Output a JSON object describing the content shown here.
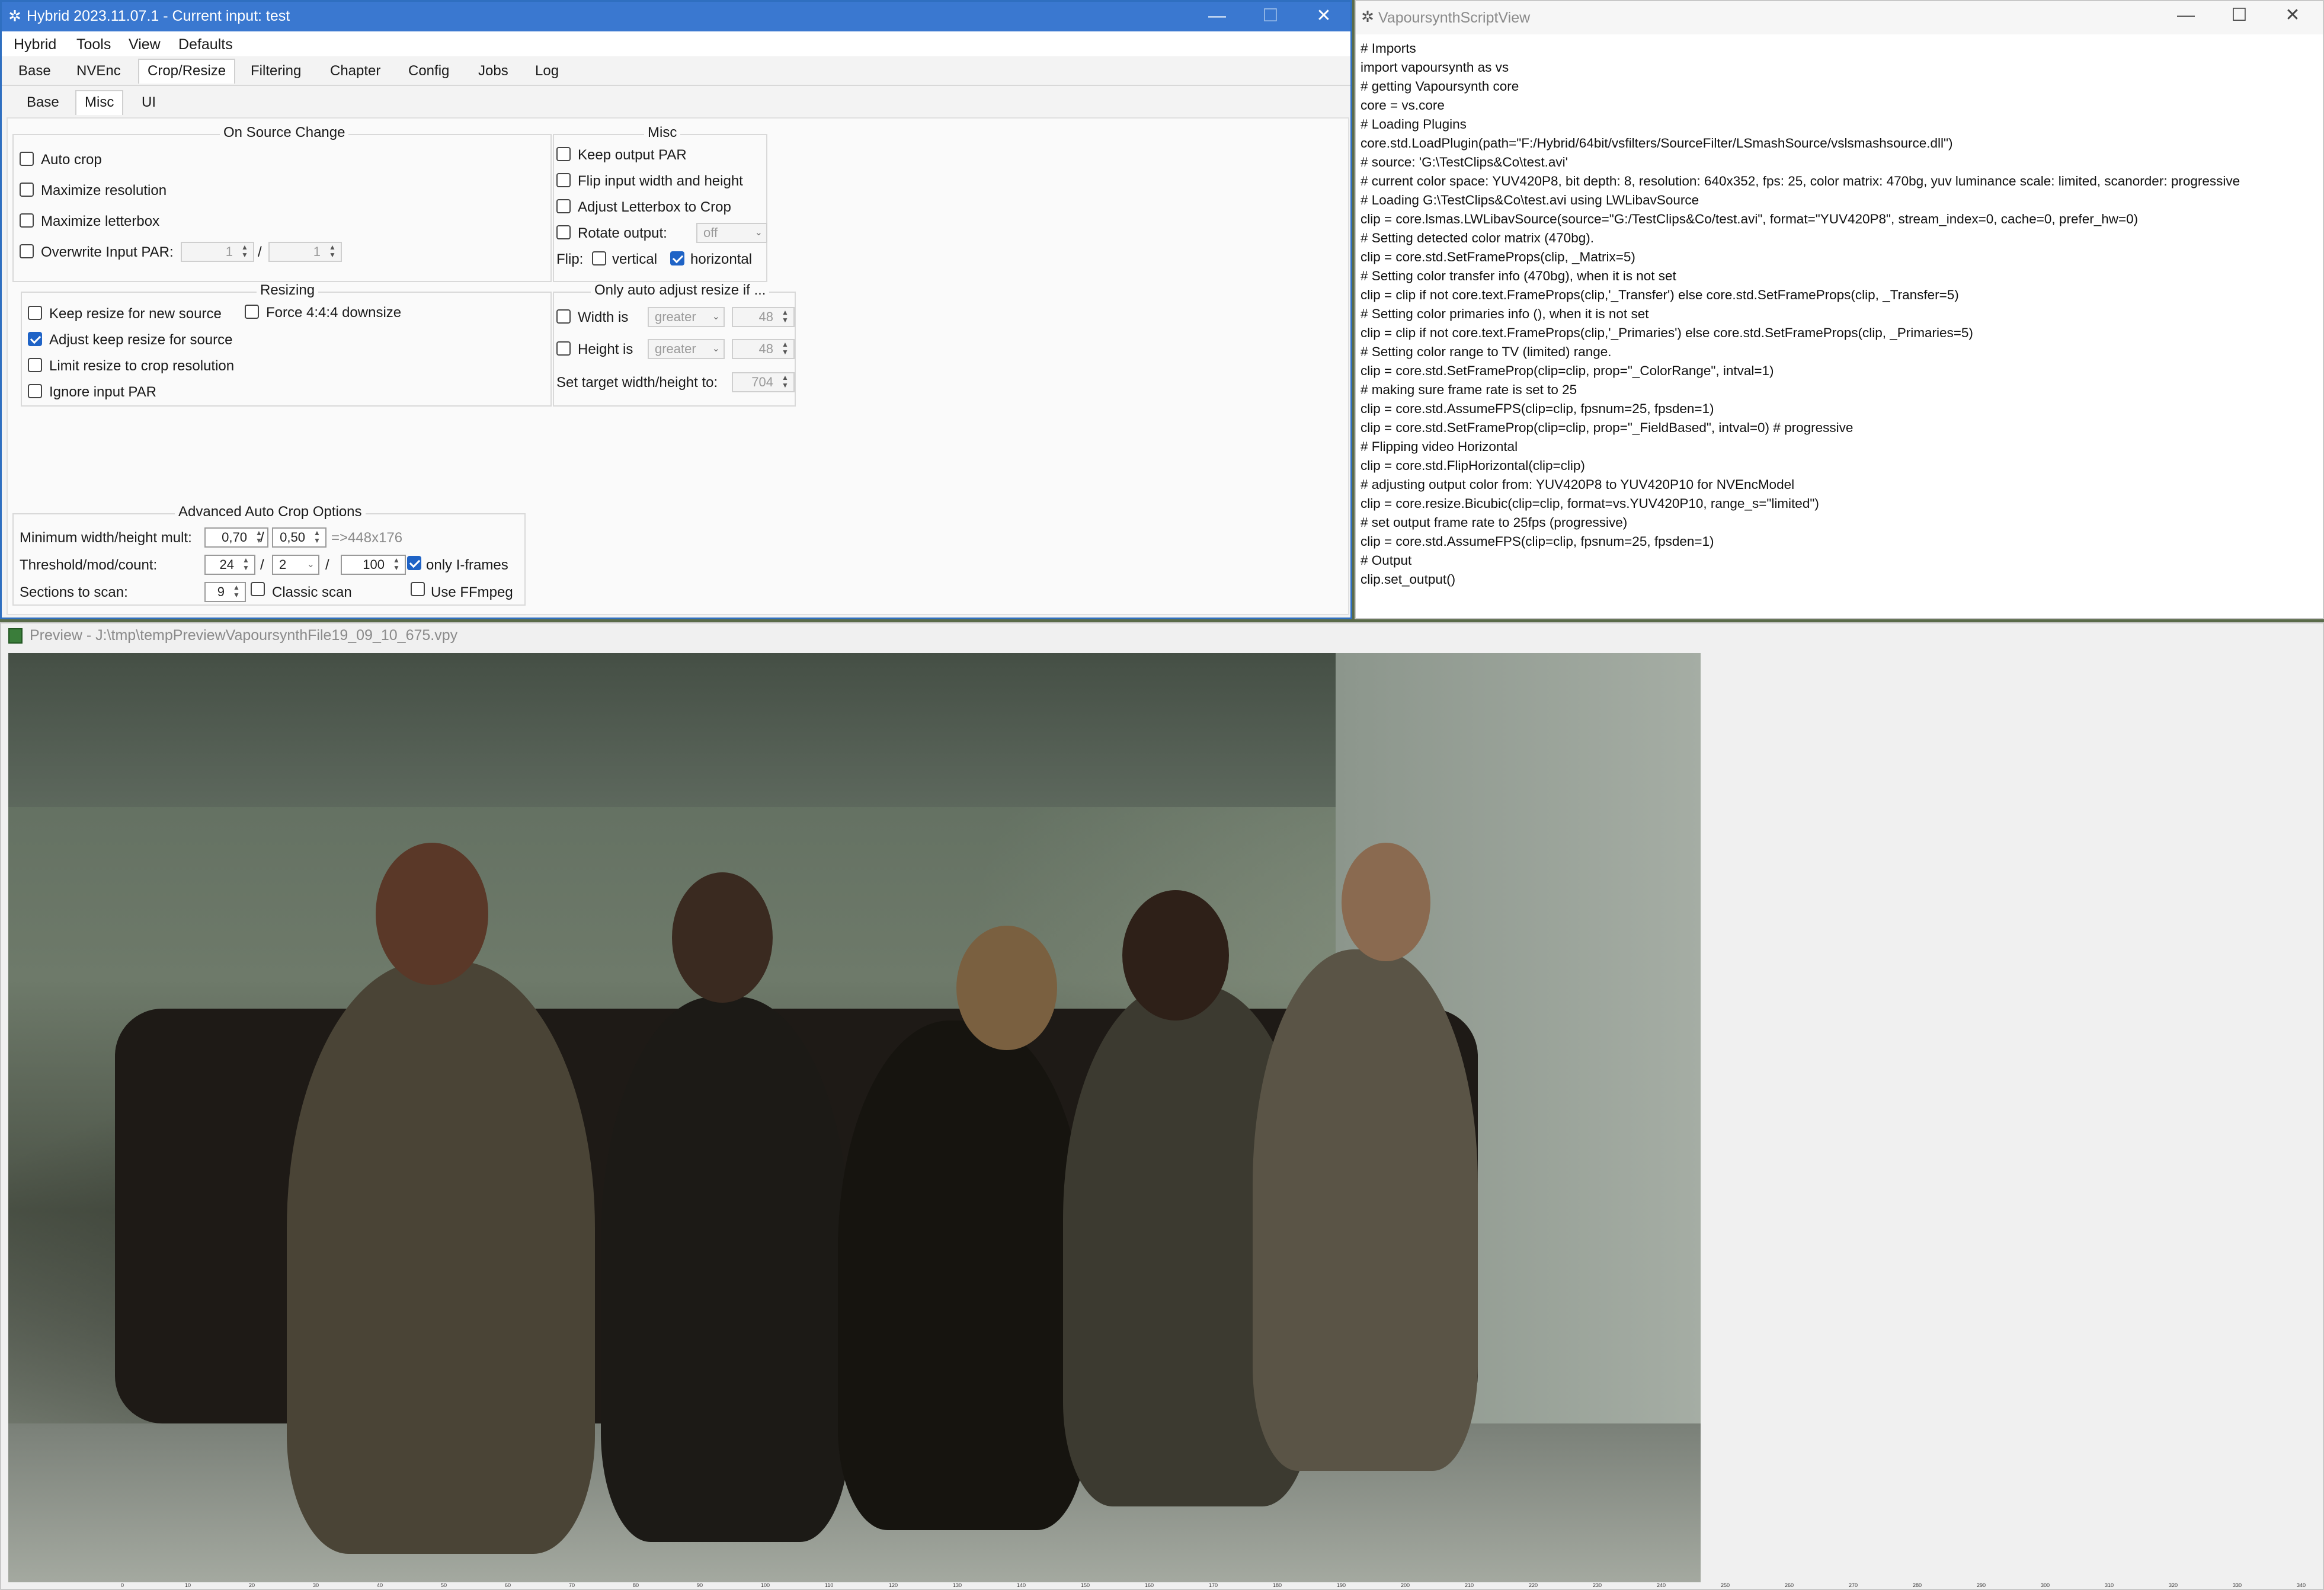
{
  "hybrid": {
    "title": "Hybrid 2023.11.07.1 - Current input: test",
    "window_controls": {
      "minimize": "—",
      "maximize": "☐",
      "close": "✕"
    },
    "menu": [
      "Hybrid",
      "Tools",
      "View",
      "Defaults"
    ],
    "tabs": [
      "Base",
      "NVEnc",
      "Crop/Resize",
      "Filtering",
      "Chapter",
      "Config",
      "Jobs",
      "Log"
    ],
    "subtabs": [
      "Base",
      "Misc",
      "UI"
    ],
    "on_source_change": {
      "title": "On Source Change",
      "auto_crop": "Auto crop",
      "maximize_resolution": "Maximize resolution",
      "maximize_letterbox": "Maximize letterbox",
      "overwrite_input_par": "Overwrite Input PAR:",
      "par_num": "1",
      "par_sep": "/",
      "par_den": "1"
    },
    "misc": {
      "title": "Misc",
      "keep_output_par": "Keep output PAR",
      "flip_input_wh": "Flip input width and height",
      "adjust_letterbox": "Adjust Letterbox to Crop",
      "rotate_output": "Rotate output:",
      "rotate_value": "off",
      "flip_label": "Flip:",
      "flip_vertical": "vertical",
      "flip_horizontal": "horizontal"
    },
    "resizing": {
      "title": "Resizing",
      "keep_resize": "Keep resize for new source",
      "force_444": "Force 4:4:4 downsize",
      "adjust_keep_resize": "Adjust keep resize for source",
      "limit_resize": "Limit resize to crop resolution",
      "ignore_par": "Ignore input PAR"
    },
    "only_auto_adjust": {
      "title": "Only auto adjust resize if ...",
      "width_is": "Width is",
      "width_cmp": "greater",
      "width_val": "48",
      "height_is": "Height is",
      "height_cmp": "greater",
      "height_val": "48",
      "set_target": "Set target width/height to:",
      "target_val": "704"
    },
    "adv_crop": {
      "title": "Advanced Auto Crop Options",
      "min_wh_mult": "Minimum width/height mult:",
      "mult_w": "0,70",
      "mult_sep": "/",
      "mult_h": "0,50",
      "result": "=>448x176",
      "threshold": "Threshold/mod/count:",
      "thr_val": "24",
      "mod_val": "2",
      "count_val": "100",
      "only_iframes": "only I-frames",
      "sections": "Sections to scan:",
      "sections_val": "9",
      "classic_scan": "Classic scan",
      "use_ffmpeg": "Use FFmpeg"
    }
  },
  "script_view": {
    "title": "VapoursynthScriptView",
    "window_controls": {
      "minimize": "—",
      "maximize": "☐",
      "close": "✕"
    },
    "lines": [
      "# Imports",
      "import vapoursynth as vs",
      "# getting Vapoursynth core",
      "core = vs.core",
      "# Loading Plugins",
      "core.std.LoadPlugin(path=\"F:/Hybrid/64bit/vsfilters/SourceFilter/LSmashSource/vslsmashsource.dll\")",
      "# source: 'G:\\TestClips&Co\\test.avi'",
      "# current color space: YUV420P8, bit depth: 8, resolution: 640x352, fps: 25, color matrix: 470bg, yuv luminance scale: limited, scanorder: progressive",
      "# Loading G:\\TestClips&Co\\test.avi using LWLibavSource",
      "clip = core.lsmas.LWLibavSource(source=\"G:/TestClips&Co/test.avi\", format=\"YUV420P8\", stream_index=0, cache=0, prefer_hw=0)",
      "# Setting detected color matrix (470bg).",
      "clip = core.std.SetFrameProps(clip, _Matrix=5)",
      "# Setting color transfer info (470bg), when it is not set",
      "clip = clip if not core.text.FrameProps(clip,'_Transfer') else core.std.SetFrameProps(clip, _Transfer=5)",
      "# Setting color primaries info (), when it is not set",
      "clip = clip if not core.text.FrameProps(clip,'_Primaries') else core.std.SetFrameProps(clip, _Primaries=5)",
      "# Setting color range to TV (limited) range.",
      "clip = core.std.SetFrameProp(clip=clip, prop=\"_ColorRange\", intval=1)",
      "# making sure frame rate is set to 25",
      "clip = core.std.AssumeFPS(clip=clip, fpsnum=25, fpsden=1)",
      "clip = core.std.SetFrameProp(clip=clip, prop=\"_FieldBased\", intval=0) # progressive",
      "# Flipping video Horizontal",
      "clip = core.std.FlipHorizontal(clip=clip)",
      "# adjusting output color from: YUV420P8 to YUV420P10 for NVEncModel",
      "clip = core.resize.Bicubic(clip=clip, format=vs.YUV420P10, range_s=\"limited\")",
      "# set output frame rate to 25fps (progressive)",
      "clip = core.std.AssumeFPS(clip=clip, fpsnum=25, fpsden=1)",
      "# Output",
      "clip.set_output()"
    ]
  },
  "preview": {
    "title": "Preview - J:\\tmp\\tempPreviewVapoursynthFile19_09_10_675.vpy",
    "ruler_ticks": [
      "0",
      "10",
      "20",
      "30",
      "40",
      "50",
      "60",
      "70",
      "80",
      "90",
      "100",
      "110",
      "120",
      "130",
      "140",
      "150",
      "160",
      "170",
      "180",
      "190",
      "200",
      "210",
      "220",
      "230",
      "240",
      "250",
      "260",
      "270",
      "280",
      "290",
      "300",
      "310",
      "320",
      "330",
      "340"
    ]
  }
}
